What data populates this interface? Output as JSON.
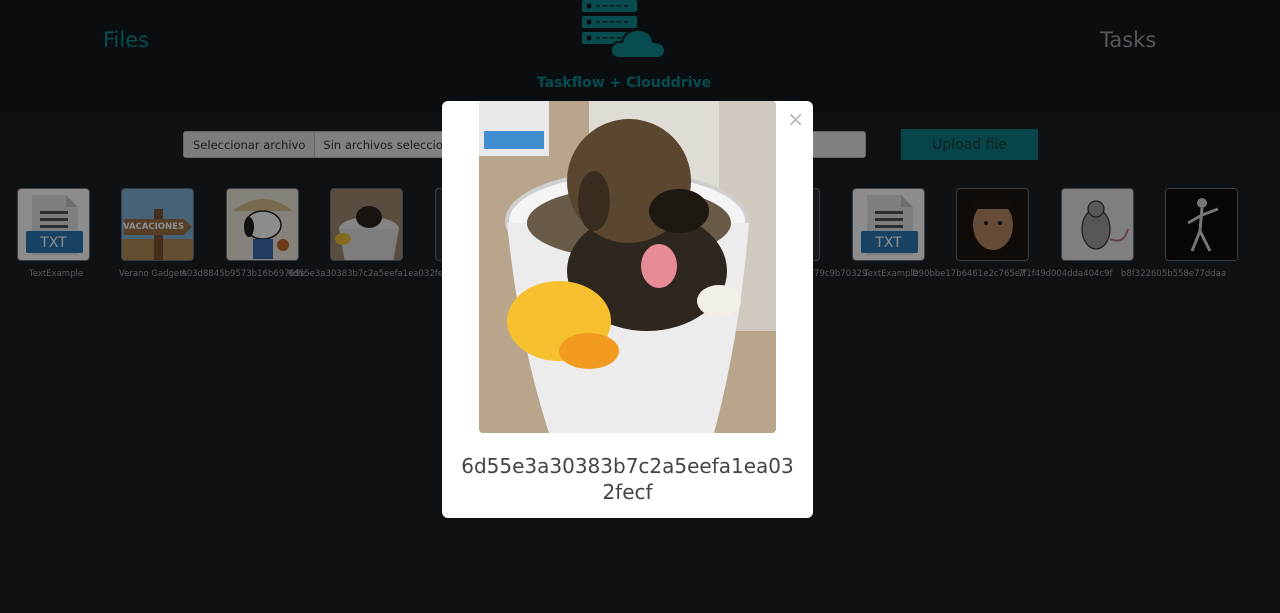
{
  "nav": {
    "files": "Files",
    "tasks": "Tasks",
    "brand": "Taskflow + Clouddrive",
    "logo": "server-cloud-logo"
  },
  "upload": {
    "choose_label": "Seleccionar archivo",
    "status": "Sin archivos seleccionados",
    "button": "Upload file"
  },
  "files": [
    {
      "name": "TextExample",
      "kind": "txt",
      "badge": "TXT"
    },
    {
      "name": "Verano Gadgets",
      "kind": "image",
      "preview": "vacaciones-sign",
      "badge": "VACACIONES"
    },
    {
      "name": "A03d8845b9573b16b69769e",
      "kind": "image",
      "preview": "snoopy"
    },
    {
      "name": "6d55e3a30383b7c2a5eefa1ea032fecf",
      "kind": "image",
      "preview": "puppy-bucket"
    },
    {
      "name": "",
      "kind": "image",
      "preview": "hidden"
    },
    {
      "name": "79c9b70329",
      "kind": "image",
      "preview": "hidden"
    },
    {
      "name": "TextExample",
      "kind": "txt",
      "badge": "TXT"
    },
    {
      "name": "D90bbe17b6461e2c765e7",
      "kind": "image",
      "preview": "man-face"
    },
    {
      "name": "7f1f49d004dda404c9f",
      "kind": "image",
      "preview": "rat-drawing"
    },
    {
      "name": "b8f322605b558e77ddaa",
      "kind": "image",
      "preview": "dancing-figure"
    }
  ],
  "modal": {
    "close": "×",
    "title": "6d55e3a30383b7c2a5eefa1ea032fecf",
    "preview": "puppy-bucket"
  },
  "colors": {
    "accent": "#0f8b93",
    "background": "#1c2127",
    "header": "#151a1f"
  }
}
